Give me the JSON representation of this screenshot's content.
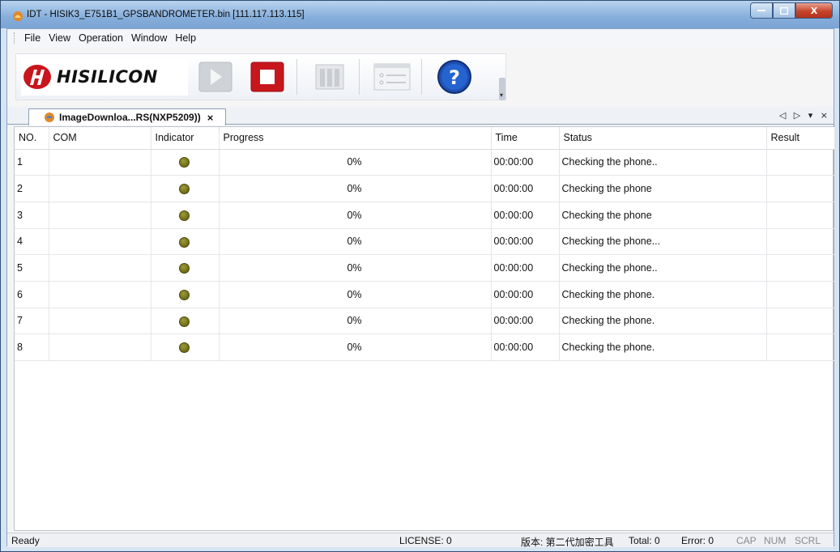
{
  "window": {
    "title": "IDT - HISIK3_E751B1_GPSBANDROMETER.bin [111.117.113.115]",
    "controls": {
      "minimize": "—",
      "maximize": "□",
      "close": "X"
    }
  },
  "menu": [
    "File",
    "View",
    "Operation",
    "Window",
    "Help"
  ],
  "toolbar": {
    "logo_text": "HISILICON",
    "buttons": [
      {
        "name": "start-icon",
        "enabled": false
      },
      {
        "name": "stop-icon",
        "enabled": true
      },
      {
        "name": "tools-icon",
        "enabled": false
      },
      {
        "name": "settings-dialog-icon",
        "enabled": false
      },
      {
        "name": "help-icon",
        "enabled": true,
        "glyph": "?"
      }
    ],
    "overflow_glyph": "▾"
  },
  "tab": {
    "label": "ImageDownloa...RS(NXP5209))",
    "close": "×",
    "controls": "◁ ▷ ▾ ×"
  },
  "table": {
    "columns": [
      "NO.",
      "COM",
      "Indicator",
      "Progress",
      "Time",
      "Status",
      "Result"
    ],
    "rows": [
      {
        "no": "1",
        "com": "",
        "progress": "0%",
        "time": "00:00:00",
        "status": "Checking the phone..",
        "result": ""
      },
      {
        "no": "2",
        "com": "",
        "progress": "0%",
        "time": "00:00:00",
        "status": "Checking the phone",
        "result": ""
      },
      {
        "no": "3",
        "com": "",
        "progress": "0%",
        "time": "00:00:00",
        "status": "Checking the phone",
        "result": ""
      },
      {
        "no": "4",
        "com": "",
        "progress": "0%",
        "time": "00:00:00",
        "status": "Checking the phone...",
        "result": ""
      },
      {
        "no": "5",
        "com": "",
        "progress": "0%",
        "time": "00:00:00",
        "status": "Checking the phone..",
        "result": ""
      },
      {
        "no": "6",
        "com": "",
        "progress": "0%",
        "time": "00:00:00",
        "status": "Checking the phone.",
        "result": ""
      },
      {
        "no": "7",
        "com": "",
        "progress": "0%",
        "time": "00:00:00",
        "status": "Checking the phone.",
        "result": ""
      },
      {
        "no": "8",
        "com": "",
        "progress": "0%",
        "time": "00:00:00",
        "status": "Checking the phone.",
        "result": ""
      }
    ]
  },
  "statusbar": {
    "ready": "Ready",
    "license": "LICENSE: 0",
    "version": "版本: 第二代加密工具",
    "total": "Total: 0",
    "error": "Error: 0",
    "cap": "CAP",
    "num": "NUM",
    "scrl": "SCRL"
  },
  "colors": {
    "indicator": "#6e6b15",
    "stop_red": "#c8161d",
    "help_blue": "#1f4fb0",
    "title_bar": "#86aedb"
  }
}
